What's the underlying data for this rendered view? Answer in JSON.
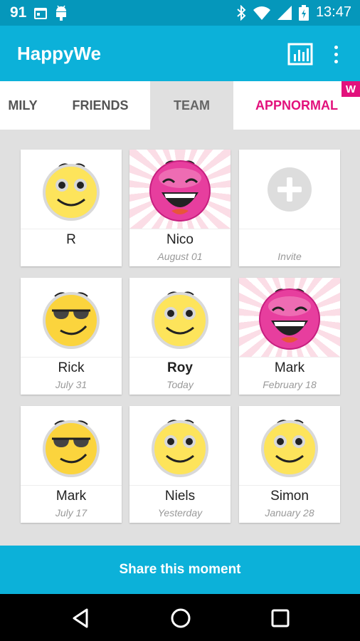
{
  "status_bar": {
    "notification_count": "91",
    "time": "13:47",
    "icons": [
      "calendar-icon",
      "android-icon",
      "bluetooth-icon",
      "wifi-icon",
      "signal-icon",
      "battery-icon"
    ]
  },
  "app_bar": {
    "title": "HappyWe",
    "actions": [
      "chart-icon",
      "overflow-menu-icon"
    ]
  },
  "tabs": [
    {
      "label": "MILY",
      "state": "inactive"
    },
    {
      "label": "FRIENDS",
      "state": "inactive"
    },
    {
      "label": "TEAM",
      "state": "selected"
    },
    {
      "label": "APPNORMAL",
      "state": "highlighted",
      "badge": "W"
    }
  ],
  "members": [
    {
      "name": "R",
      "date": "",
      "emoji": "smile-icon"
    },
    {
      "name": "Nico",
      "date": "August 01",
      "emoji": "laughing-icon"
    },
    {
      "name": "",
      "date": "Invite",
      "emoji": "add-icon"
    },
    {
      "name": "Rick",
      "date": "July 31",
      "emoji": "smirk-icon"
    },
    {
      "name": "Roy",
      "date": "Today",
      "emoji": "smile-icon"
    },
    {
      "name": "Mark",
      "date": "February 18",
      "emoji": "laughing-icon"
    },
    {
      "name": "Mark",
      "date": "July 17",
      "emoji": "smirk-icon"
    },
    {
      "name": "Niels",
      "date": "Yesterday",
      "emoji": "smile-icon"
    },
    {
      "name": "Simon",
      "date": "January 28",
      "emoji": "smile-icon"
    }
  ],
  "share_button": {
    "label": "Share this moment"
  },
  "colors": {
    "status_bar": "#0597bb",
    "app_bar": "#0cb1d9",
    "accent_pink": "#e2117c",
    "grid_background": "#e0e0e0"
  },
  "nav_bar": {
    "buttons": [
      "back-icon",
      "home-icon",
      "recents-icon"
    ]
  }
}
